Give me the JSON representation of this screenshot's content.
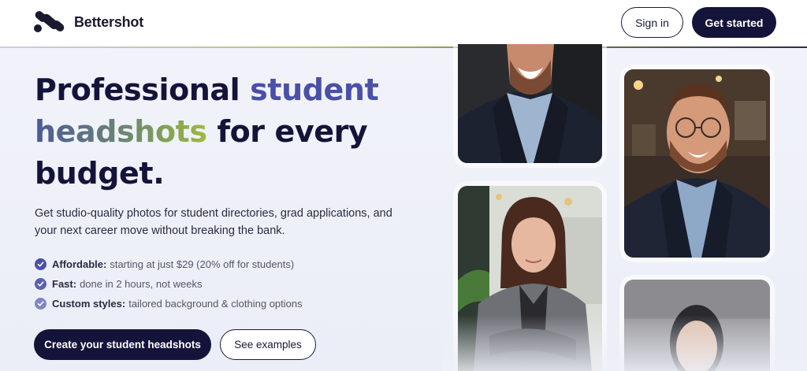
{
  "header": {
    "brand": "Bettershot",
    "sign_in": "Sign in",
    "get_started": "Get started"
  },
  "hero": {
    "title_part1": "Professional ",
    "title_highlight1": "student",
    "title_highlight2": "headshots",
    "title_part2": " for every",
    "title_part3": "budget.",
    "subtitle": "Get studio-quality photos for student directories, grad applications, and your next career move without breaking the bank.",
    "features": [
      {
        "label": "Affordable",
        "sep": ":",
        "text": "starting at just $29 (20% off for students)",
        "icon": "check-circle-icon",
        "color": "#4b4fa6"
      },
      {
        "label": "Fast:",
        "sep": "",
        "text": "done in 2 hours, not weeks",
        "icon": "check-circle-icon",
        "color": "#5a5fb0"
      },
      {
        "label": "Custom styles:",
        "sep": "",
        "text": "tailored background & clothing options",
        "icon": "check-circle-icon",
        "color": "#8085c4"
      }
    ],
    "cta_primary": "Create your student headshots",
    "cta_secondary": "See examples"
  },
  "colors": {
    "navy": "#14143a",
    "accent_blue": "#4a4fa8",
    "accent_green": "#9dbb3f"
  },
  "gallery": {
    "images": [
      "headshot-man-suit",
      "headshot-man-glasses",
      "headshot-woman-gray-blazer",
      "headshot-woman-partial"
    ]
  }
}
